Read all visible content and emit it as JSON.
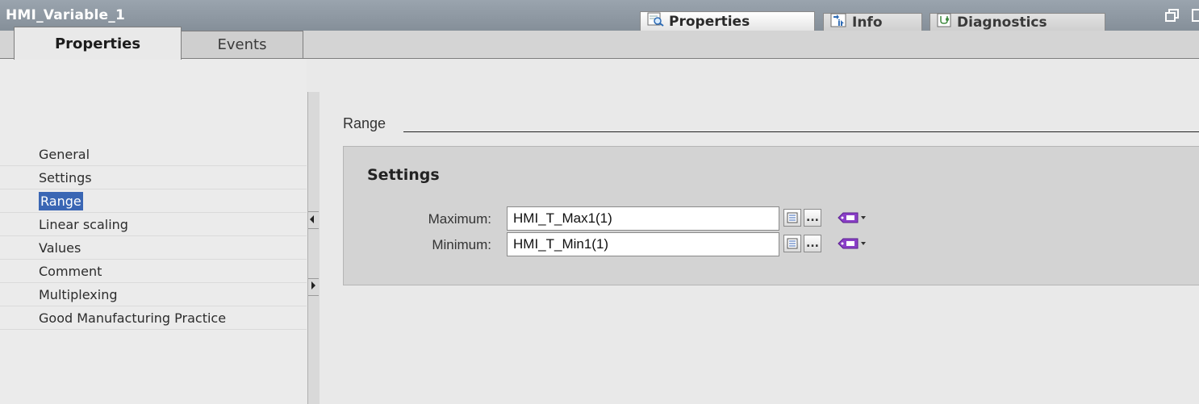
{
  "window": {
    "title": "HMI_Variable_1",
    "inspector_tabs": [
      {
        "label": "Properties",
        "icon": "properties-icon",
        "active": true
      },
      {
        "label": "Info",
        "icon": "info-icon",
        "active": false
      },
      {
        "label": "Diagnostics",
        "icon": "diagnostics-icon",
        "active": false
      }
    ]
  },
  "property_tabs": [
    {
      "label": "Properties",
      "active": true
    },
    {
      "label": "Events",
      "active": false
    }
  ],
  "nav": {
    "selected": "Range",
    "items": [
      {
        "label": "General"
      },
      {
        "label": "Settings"
      },
      {
        "label": "Range"
      },
      {
        "label": "Linear scaling"
      },
      {
        "label": "Values"
      },
      {
        "label": "Comment"
      },
      {
        "label": "Multiplexing"
      },
      {
        "label": "Good Manufacturing Practice"
      }
    ]
  },
  "main": {
    "section_title": "Range",
    "group": {
      "title": "Settings",
      "fields": [
        {
          "label": "Maximum:",
          "value": "HMI_T_Max1(1)"
        },
        {
          "label": "Minimum:",
          "value": "HMI_T_Min1(1)"
        }
      ]
    },
    "ellipsis_label": "..."
  },
  "colors": {
    "selection": "#3a66b4",
    "title_bar": "#8f99a3",
    "tag_icon": "#8a3fc7"
  }
}
